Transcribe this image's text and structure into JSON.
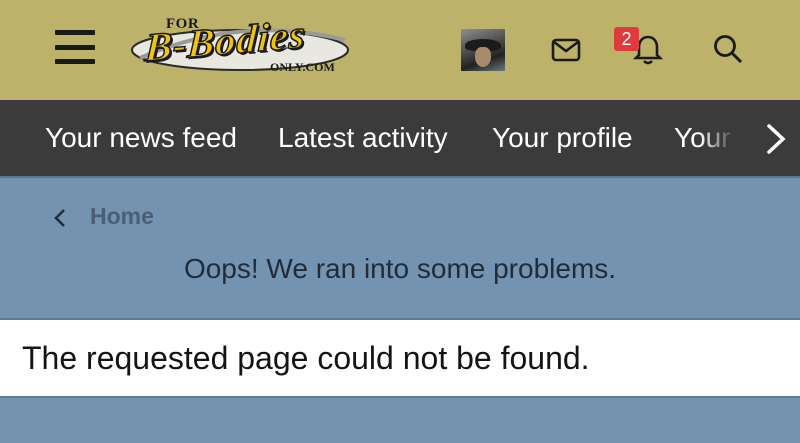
{
  "header": {
    "logo": {
      "text_for": "FOR",
      "text_main": "B-Bodies",
      "text_only": "ONLY.COM"
    },
    "notifications_badge": "2",
    "icons": [
      "menu-icon",
      "mail-icon",
      "bell-icon",
      "search-icon"
    ],
    "colors": {
      "header_bg": "#bdb26a",
      "badge": "#e03a3a",
      "logo_yellow": "#f1c40f"
    }
  },
  "nav": {
    "items": [
      {
        "label": "Your news feed"
      },
      {
        "label": "Latest activity"
      },
      {
        "label": "Your profile"
      },
      {
        "label": "Your"
      }
    ],
    "colors": {
      "bg": "#3b3b3b",
      "text": "#ffffff"
    }
  },
  "breadcrumb": {
    "home_label": "Home"
  },
  "main": {
    "title": "Oops! We ran into some problems.",
    "error_message": "The requested page could not be found.",
    "colors": {
      "bg": "#7393b0",
      "message_bg": "#ffffff"
    }
  }
}
